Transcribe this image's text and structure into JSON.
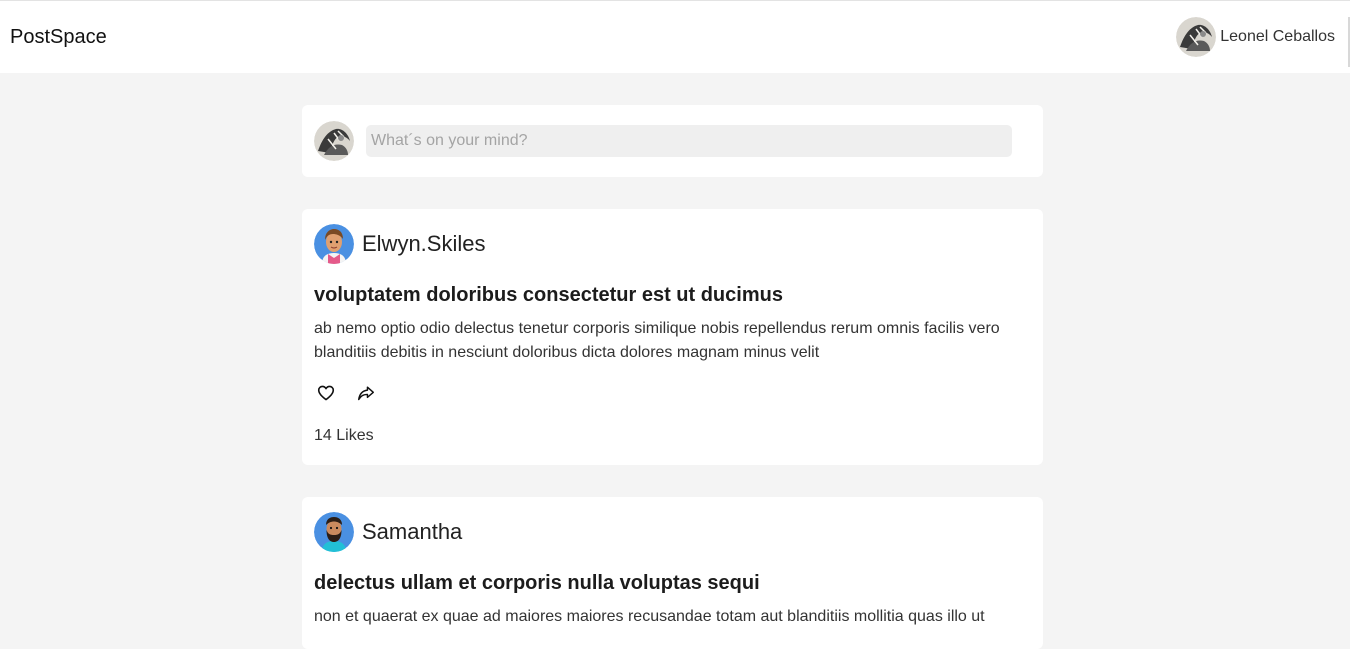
{
  "app": {
    "brand": "PostSpace"
  },
  "header": {
    "user_name": "Leonel Ceballos",
    "avatar_icon": "user-avatar-sketch"
  },
  "composer": {
    "placeholder": "What´s on your mind?",
    "value": ""
  },
  "posts": [
    {
      "author": "Elwyn.Skiles",
      "avatar_icon": "avatar-blue-woman",
      "title": "voluptatem doloribus consectetur est ut ducimus",
      "body": "ab nemo optio odio delectus tenetur corporis similique nobis repellendus rerum omnis facilis vero blanditiis debitis in nesciunt doloribus dicta dolores magnam minus velit",
      "likes_label": "14 Likes"
    },
    {
      "author": "Samantha",
      "avatar_icon": "avatar-blue-bearded-man",
      "title": "delectus ullam et corporis nulla voluptas sequi",
      "body": "non et quaerat ex quae ad maiores maiores recusandae totam aut blanditiis mollitia quas illo ut"
    }
  ],
  "colors": {
    "page_bg": "#f4f4f4",
    "card_bg": "#ffffff",
    "input_bg": "#efefef",
    "avatar_blue": "#4a90e2"
  }
}
